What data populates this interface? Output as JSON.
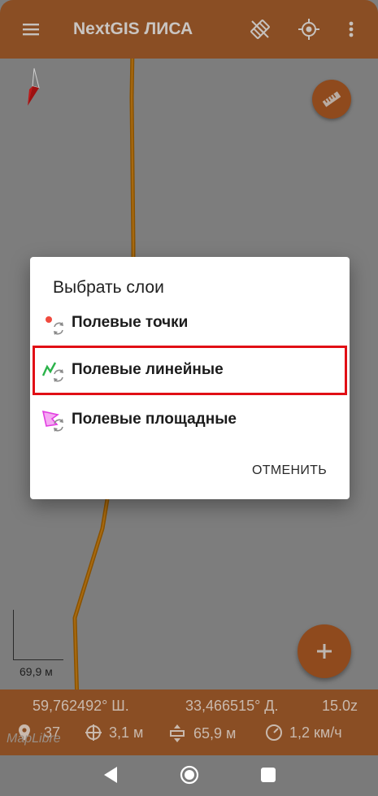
{
  "appbar": {
    "title": "NextGIS ЛИСА",
    "icons": [
      "menu-icon",
      "gps-off-icon",
      "my-location-icon",
      "more-vert-icon"
    ]
  },
  "map": {
    "scale_label": "69,9 м",
    "attribution": "MapLibre"
  },
  "status": {
    "latitude": "59,762492° Ш.",
    "longitude": "33,466515° Д.",
    "zoom": "15.0z",
    "satellites": "37",
    "accuracy": "3,1 м",
    "altitude": "65,9 м",
    "speed": "1,2 км/ч"
  },
  "dialog": {
    "title": "Выбрать слои",
    "items": [
      {
        "label": "Полевые точки",
        "icon": "point-layer-icon"
      },
      {
        "label": "Полевые линейные",
        "icon": "line-layer-icon"
      },
      {
        "label": "Полевые площадные",
        "icon": "polygon-layer-icon"
      }
    ],
    "highlighted_index": 1,
    "cancel_label": "ОТМЕНИТЬ"
  },
  "colors": {
    "accent": "#f47b20",
    "highlight_border": "#e10f15"
  }
}
